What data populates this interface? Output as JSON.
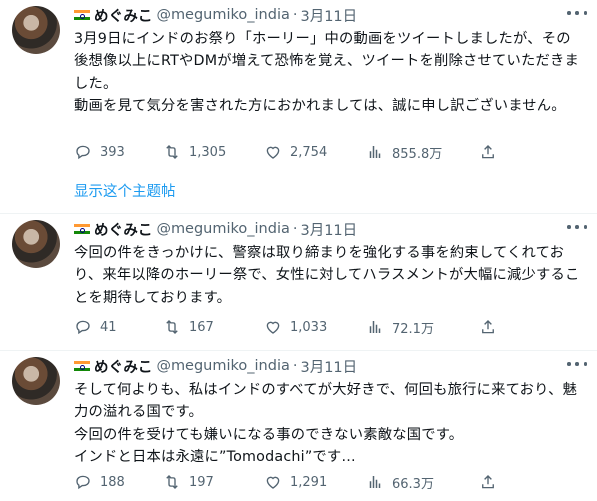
{
  "tweets": [
    {
      "author": "めぐみこ",
      "handle": "@megumiko_india",
      "date": "3月11日",
      "text": "3月9日にインドのお祭り「ホーリー」中の動画をツイートしましたが、その後想像以上にRTやDMが増えて恐怖を覚え、ツイートを削除させていただきました。\n動画を見て気分を害された方におかれましては、誠に申し訳ございません。",
      "replies": "393",
      "retweets": "1,305",
      "likes": "2,754",
      "views": "855.8万",
      "show_thread": "显示这个主题帖"
    },
    {
      "author": "めぐみこ",
      "handle": "@megumiko_india",
      "date": "3月11日",
      "text": "今回の件をきっかけに、警察は取り締まりを強化する事を約束してくれており、来年以降のホーリー祭で、女性に対してハラスメントが大幅に減少することを期待しております。",
      "replies": "41",
      "retweets": "167",
      "likes": "1,033",
      "views": "72.1万"
    },
    {
      "author": "めぐみこ",
      "handle": "@megumiko_india",
      "date": "3月11日",
      "text": "そして何よりも、私はインドのすべてが大好きで、何回も旅行に来ており、魅力の溢れる国です。\n今回の件を受けても嫌いになる事のできない素敵な国です。\nインドと日本は永遠に”Tomodachi”です…",
      "replies": "188",
      "retweets": "197",
      "likes": "1,291",
      "views": "66.3万"
    }
  ],
  "colors": {
    "accent": "#1d9bf0",
    "secondary": "#536471",
    "text": "#0f1419"
  },
  "icons": [
    "more-icon",
    "reply-icon",
    "retweet-icon",
    "like-icon",
    "views-icon",
    "share-icon",
    "india-flag-icon"
  ]
}
